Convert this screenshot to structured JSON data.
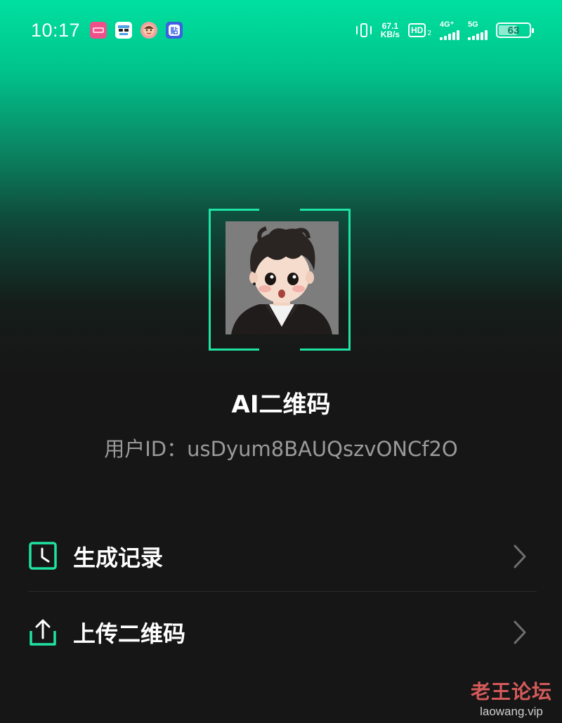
{
  "status_bar": {
    "time": "10:17",
    "net_speed_value": "67.1",
    "net_speed_unit": "KB/s",
    "hd_label": "HD",
    "hd_sub": "2",
    "sim1_label": "4G⁺",
    "sim2_label": "5G",
    "battery_level": "63",
    "app_icons": [
      "app-icon-pink",
      "app-icon-glasses",
      "app-icon-face",
      "app-icon-tieba"
    ]
  },
  "profile": {
    "title": "AI二维码",
    "user_id_label": "用户ID：",
    "user_id_value": "usDyum8BAUQszvONCf2O"
  },
  "menu": {
    "items": [
      {
        "label": "生成记录",
        "icon": "history-clock-icon"
      },
      {
        "label": "上传二维码",
        "icon": "upload-icon"
      }
    ]
  },
  "watermark": {
    "name": "老王论坛",
    "url": "laowang.vip"
  },
  "colors": {
    "accent": "#1ee3a3",
    "gradient_top": "#00e0a0",
    "background": "#161616",
    "watermark_red": "#d55a5a"
  }
}
